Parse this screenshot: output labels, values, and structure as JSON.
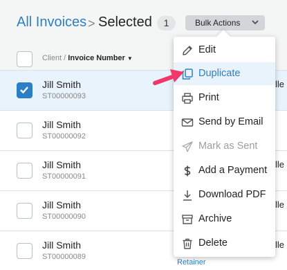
{
  "breadcrumb": {
    "link": "All Invoices",
    "separator": ">",
    "current": "Selected",
    "count": "1"
  },
  "bulk_actions": {
    "label": "Bulk Actions"
  },
  "table": {
    "column_prefix": "Client / ",
    "column_sort": "Invoice Number",
    "sort_icon": "▼",
    "rows": [
      {
        "client": "Jill Smith",
        "number": "ST00000093",
        "selected": true,
        "cut": "lle"
      },
      {
        "client": "Jill Smith",
        "number": "ST00000092",
        "selected": false,
        "cut": ""
      },
      {
        "client": "Jill Smith",
        "number": "ST00000091",
        "selected": false,
        "cut": "lle"
      },
      {
        "client": "Jill Smith",
        "number": "ST00000090",
        "selected": false,
        "cut": "lle"
      },
      {
        "client": "Jill Smith",
        "number": "ST00000089",
        "selected": false,
        "cut": "lle",
        "tag": "Retainer"
      }
    ]
  },
  "menu": {
    "items": [
      {
        "label": "Edit",
        "icon": "pencil-icon"
      },
      {
        "label": "Duplicate",
        "icon": "copy-icon",
        "highlighted": true
      },
      {
        "label": "Print",
        "icon": "printer-icon"
      },
      {
        "label": "Send by Email",
        "icon": "envelope-icon"
      },
      {
        "label": "Mark as Sent",
        "icon": "paper-plane-icon",
        "disabled": true
      },
      {
        "label": "Add a Payment",
        "icon": "dollar-icon"
      },
      {
        "label": "Download PDF",
        "icon": "download-icon"
      },
      {
        "label": "Archive",
        "icon": "archive-icon"
      },
      {
        "label": "Delete",
        "icon": "trash-icon"
      }
    ]
  },
  "colors": {
    "accent": "#2d7fc5",
    "arrow": "#f0386b",
    "selected_row": "#e9f3fb"
  }
}
